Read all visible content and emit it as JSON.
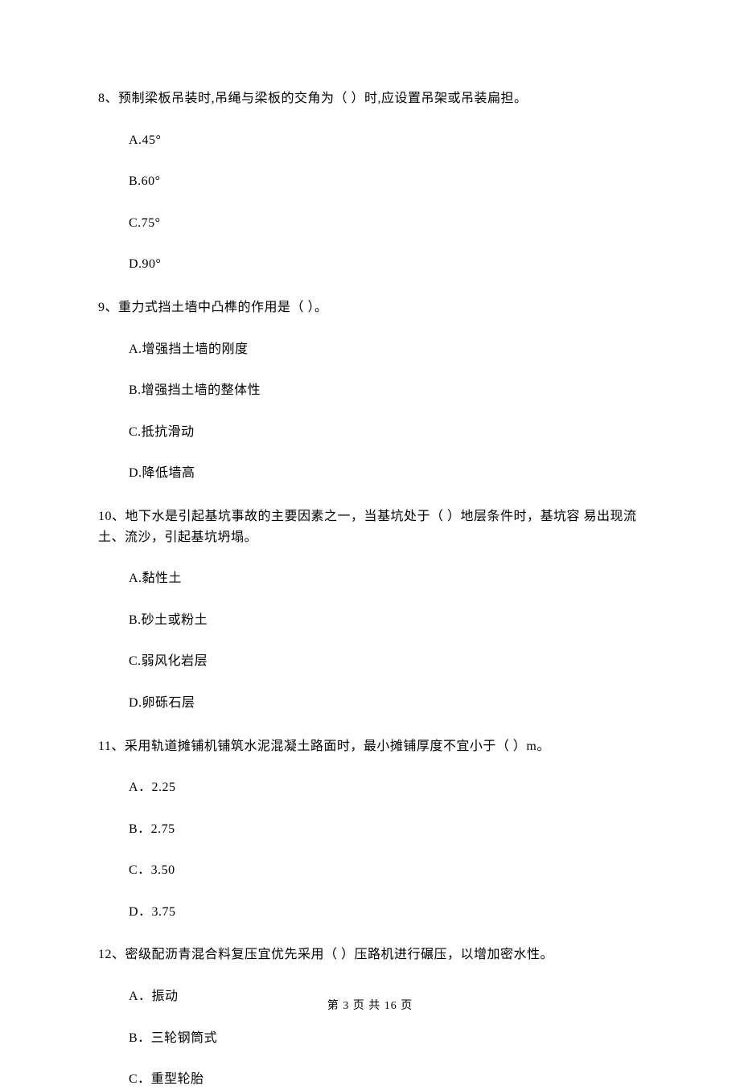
{
  "questions": [
    {
      "stem": "8、预制梁板吊装时,吊绳与梁板的交角为（    ）时,应设置吊架或吊装扁担。",
      "options": [
        "A.45°",
        "B.60°",
        "C.75°",
        "D.90°"
      ]
    },
    {
      "stem": "9、重力式挡土墙中凸榫的作用是（    ）。",
      "options": [
        "A.增强挡土墙的刚度",
        "B.增强挡土墙的整体性",
        "C.抵抗滑动",
        "D.降低墙高"
      ]
    },
    {
      "stem": "10、地下水是引起基坑事故的主要因素之一，当基坑处于（    ）地层条件时，基坑容 易出现流土、流沙，引起基坑坍塌。",
      "options": [
        "A.黏性土",
        "B.砂土或粉土",
        "C.弱风化岩层",
        "D.卵砾石层"
      ]
    },
    {
      "stem": "11、采用轨道摊铺机铺筑水泥混凝土路面时，最小摊铺厚度不宜小于（    ）m。",
      "options": [
        "A．2.25",
        "B．2.75",
        "C．3.50",
        "D．3.75"
      ]
    },
    {
      "stem": "12、密级配沥青混合料复压宜优先采用（    ）压路机进行碾压，以增加密水性。",
      "options": [
        "A．振动",
        "B．三轮钢筒式",
        "C．重型轮胎"
      ]
    }
  ],
  "footer": "第 3 页 共 16 页"
}
